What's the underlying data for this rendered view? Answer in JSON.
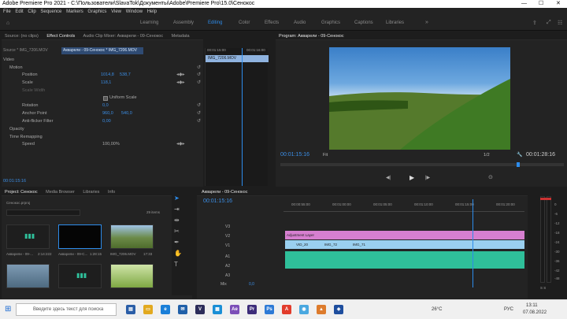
{
  "window": {
    "title": "Adobe Premiere Pro 2021 - C:\\Пользователи\\SlavaTok\\Документы\\Adobe\\Premiere Pro\\15.0\\Сенокос",
    "minimize": "—",
    "maximize": "☐",
    "close": "✕"
  },
  "menu": [
    "File",
    "Edit",
    "Clip",
    "Sequence",
    "Markers",
    "Graphics",
    "View",
    "Window",
    "Help"
  ],
  "workspaces": [
    "Learning",
    "Assembly",
    "Editing",
    "Color",
    "Effects",
    "Audio",
    "Graphics",
    "Captions",
    "Libraries"
  ],
  "active_workspace": "Editing",
  "effect_controls": {
    "tabs": [
      "Source: (no clips)",
      "Effect Controls",
      "Audio Clip Mixer: Акварели - 09-Сенокос",
      "Metadata"
    ],
    "clip_selector": "Source * IMG_7206.MOV",
    "sequence_selector": "Акварели - 09-Сенокос * IMG_7206.MOV",
    "video_label": "Video",
    "motion": "Motion",
    "position_label": "Position",
    "position_x": "1014,8",
    "position_y": "538,7",
    "scale_label": "Scale",
    "scale": "118,1",
    "scale_width": "Scale Width",
    "uniform_scale": "Uniform Scale",
    "rotation_label": "Rotation",
    "rotation": "0,0",
    "anchor_label": "Anchor Point",
    "anchor_x": "960,0",
    "anchor_y": "540,0",
    "flicker_label": "Anti-flicker Filter",
    "flicker": "0,00",
    "opacity": "Opacity",
    "time_remapping": "Time Remapping",
    "speed_label": "Speed",
    "speed": "100,00%",
    "timecode": "00:01:15:16",
    "tl_start": "00:01:15:00",
    "tl_end": "00:01:16:00",
    "tl_clip": "IMG_7206.MOV"
  },
  "program": {
    "title": "Program: Акварели - 09-Сенокос",
    "timecode": "00:01:15:16",
    "fit": "Fit",
    "resolution": "1/2",
    "duration": "00:01:28:16"
  },
  "project": {
    "tabs": [
      "Project: Сенокос",
      "Media Browser",
      "Libraries",
      "Info"
    ],
    "file": "Сенокос.prproj",
    "items_count": "29 items",
    "items": [
      {
        "name": "Акварели - 09-...",
        "dur": "2:14:222"
      },
      {
        "name": "Акварели - 09-C...",
        "dur": "1:28:15"
      },
      {
        "name": "IMG_7206.MOV",
        "dur": "17:33"
      }
    ]
  },
  "timeline": {
    "title": "Акварели - 09-Сенокос",
    "timecode": "00:01:15:16",
    "ruler": [
      "00:00:55:00",
      "00:01:00:00",
      "00:01:05:00",
      "00:01:10:00",
      "00:01:15:00",
      "00:01:20:00"
    ],
    "tracks_video": [
      "V3",
      "V2",
      "V1"
    ],
    "tracks_audio": [
      "A1",
      "A2",
      "A3"
    ],
    "mix_label": "Mix",
    "mix_value": "0,0",
    "adjustment_layer": "Adjustment Layer",
    "clips": [
      "VID_20",
      "IMG_72",
      "IMG_71"
    ]
  },
  "meters": {
    "labels": [
      "0",
      "-6",
      "-12",
      "-18",
      "-24",
      "-30",
      "-36",
      "-42",
      "-48",
      "-54"
    ],
    "solo": "S S"
  },
  "taskbar": {
    "search": "Введите здесь текст для поиска",
    "temp": "26°C",
    "lang": "РУС",
    "time": "13:11",
    "date": "07.08.2022"
  },
  "colors": {
    "accent": "#2d8ceb",
    "adjustment": "#d67fd0",
    "video_clip": "#9ad0f0",
    "audio": "#2fbf9a",
    "playhead": "#2d8ceb"
  }
}
